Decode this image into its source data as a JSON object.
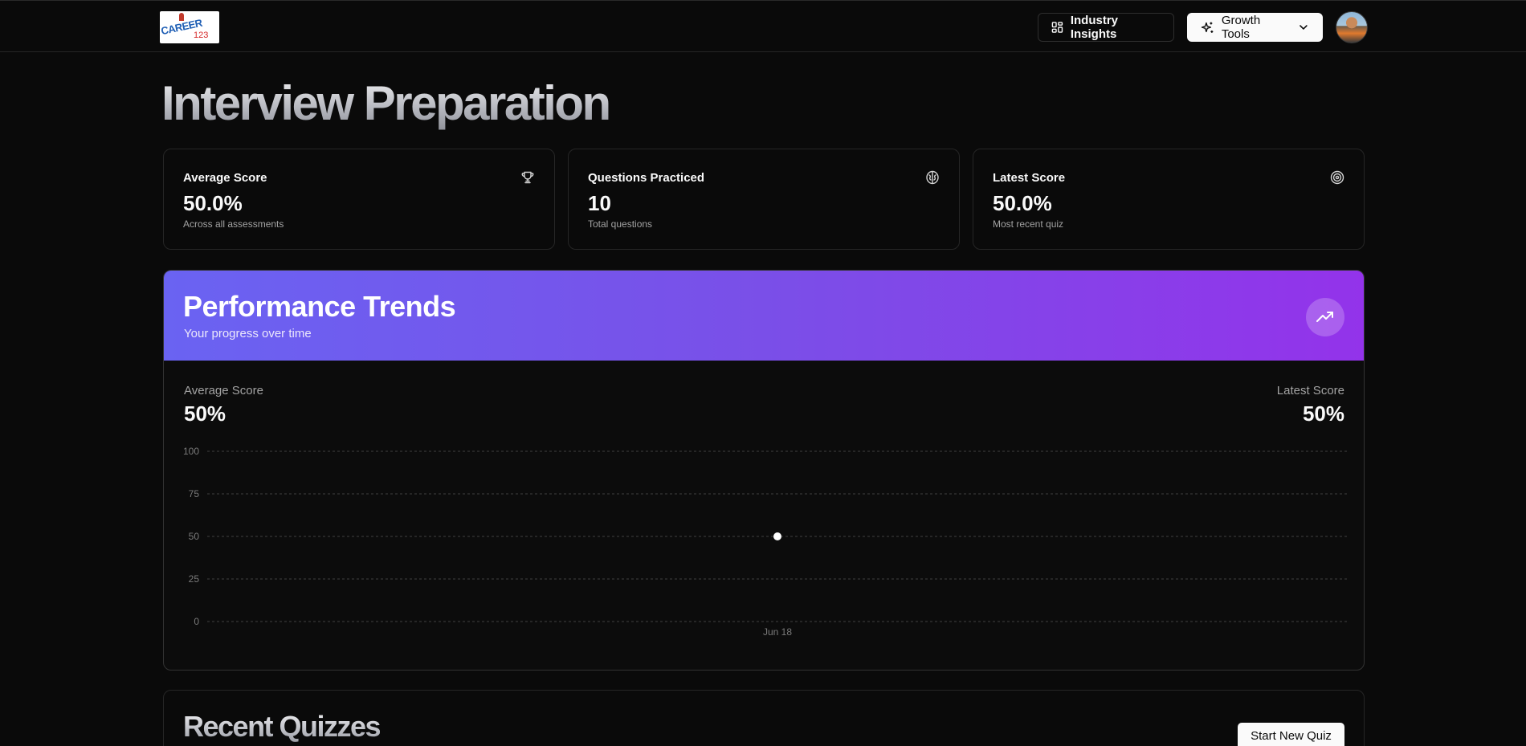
{
  "header": {
    "logo": {
      "main": "CAREER",
      "number": "123"
    },
    "industry_insights_label": "Industry Insights",
    "growth_tools_label": "Growth Tools"
  },
  "page": {
    "title": "Interview Preparation"
  },
  "stats": [
    {
      "label": "Average Score",
      "value": "50.0%",
      "sub": "Across all assessments",
      "icon": "trophy-icon"
    },
    {
      "label": "Questions Practiced",
      "value": "10",
      "sub": "Total questions",
      "icon": "brain-icon"
    },
    {
      "label": "Latest Score",
      "value": "50.0%",
      "sub": "Most recent quiz",
      "icon": "target-icon"
    }
  ],
  "performance": {
    "title": "Performance Trends",
    "subtitle": "Your progress over time",
    "average_label": "Average Score",
    "average_value": "50%",
    "latest_label": "Latest Score",
    "latest_value": "50%",
    "gradient": [
      "#6a63f2",
      "#9333ea"
    ]
  },
  "chart_data": {
    "type": "line",
    "x": [
      "Jun 18"
    ],
    "series": [
      {
        "values": [
          50
        ]
      }
    ],
    "yticks": [
      0,
      25,
      50,
      75,
      100
    ],
    "ylim": [
      0,
      100
    ],
    "grid": true,
    "title": "",
    "xlabel": "",
    "ylabel": ""
  },
  "recent": {
    "title": "Recent Quizzes",
    "start_label": "Start New Quiz"
  }
}
